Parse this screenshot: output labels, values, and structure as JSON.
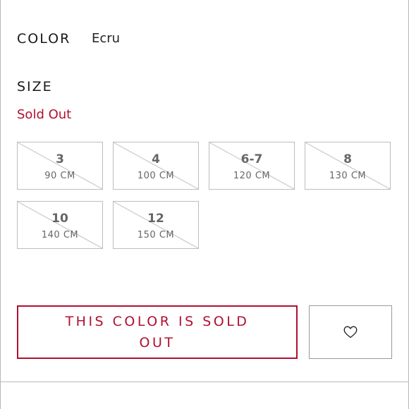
{
  "color": {
    "label": "COLOR",
    "value": "Ecru"
  },
  "size": {
    "label": "SIZE",
    "status": "Sold Out",
    "options": [
      {
        "size": "3",
        "length": "90 CM",
        "available": false
      },
      {
        "size": "4",
        "length": "100 CM",
        "available": false
      },
      {
        "size": "6-7",
        "length": "120 CM",
        "available": false
      },
      {
        "size": "8",
        "length": "130 CM",
        "available": false
      },
      {
        "size": "10",
        "length": "140 CM",
        "available": false
      },
      {
        "size": "12",
        "length": "150 CM",
        "available": false
      }
    ]
  },
  "actions": {
    "sold_out_label": "THIS COLOR IS SOLD OUT",
    "wishlist_icon": "heart-icon"
  },
  "colors": {
    "accent": "#b01030",
    "border": "#bdbdbd",
    "muted_text": "#666666"
  }
}
